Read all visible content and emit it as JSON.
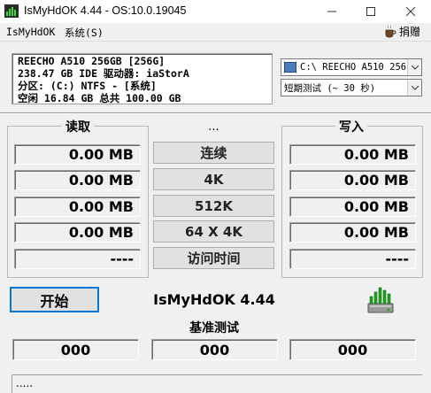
{
  "window": {
    "title": "IsMyHdOK 4.44 - OS:10.0.19045"
  },
  "menu": {
    "items": [
      "IsMyHdOK",
      "系统(S)"
    ],
    "donate_label": "捐赠"
  },
  "drive_info": {
    "lines": [
      "REECHO A510 256GB [256G]",
      "238.47 GB  IDE 驱动器: iaStorA",
      "分区: (C:) NTFS - [系统]",
      "空闲 16.84 GB 总共 100.00 GB"
    ]
  },
  "selectors": {
    "drive": "C:\\ REECHO A510 256(",
    "test_mode": "短期测试 (~ 30 秒)"
  },
  "read": {
    "label": "读取",
    "values": [
      "0.00 MB",
      "0.00 MB",
      "0.00 MB",
      "0.00 MB",
      "----"
    ]
  },
  "write": {
    "label": "写入",
    "values": [
      "0.00 MB",
      "0.00 MB",
      "0.00 MB",
      "0.00 MB",
      "----"
    ]
  },
  "middle": {
    "dots": "...",
    "buttons": [
      "连续",
      "4K",
      "512K",
      "64 X 4K",
      "访问时间"
    ]
  },
  "actions": {
    "start_label": "开始",
    "app_name": "IsMyHdOK 4.44"
  },
  "benchmark": {
    "label": "基准测试",
    "values": [
      "000",
      "000",
      "000"
    ]
  },
  "status": {
    "text": "....."
  },
  "colors": {
    "focus_border": "#0078d7",
    "window_bg": "#f0f0f0",
    "icon_green": "#1aa31a"
  },
  "icons": [
    "app-icon",
    "minimize-icon",
    "maximize-icon",
    "close-icon",
    "donate-cup-icon",
    "drive-icon",
    "dropdown-arrow-icon",
    "benchmark-hdd-icon"
  ]
}
